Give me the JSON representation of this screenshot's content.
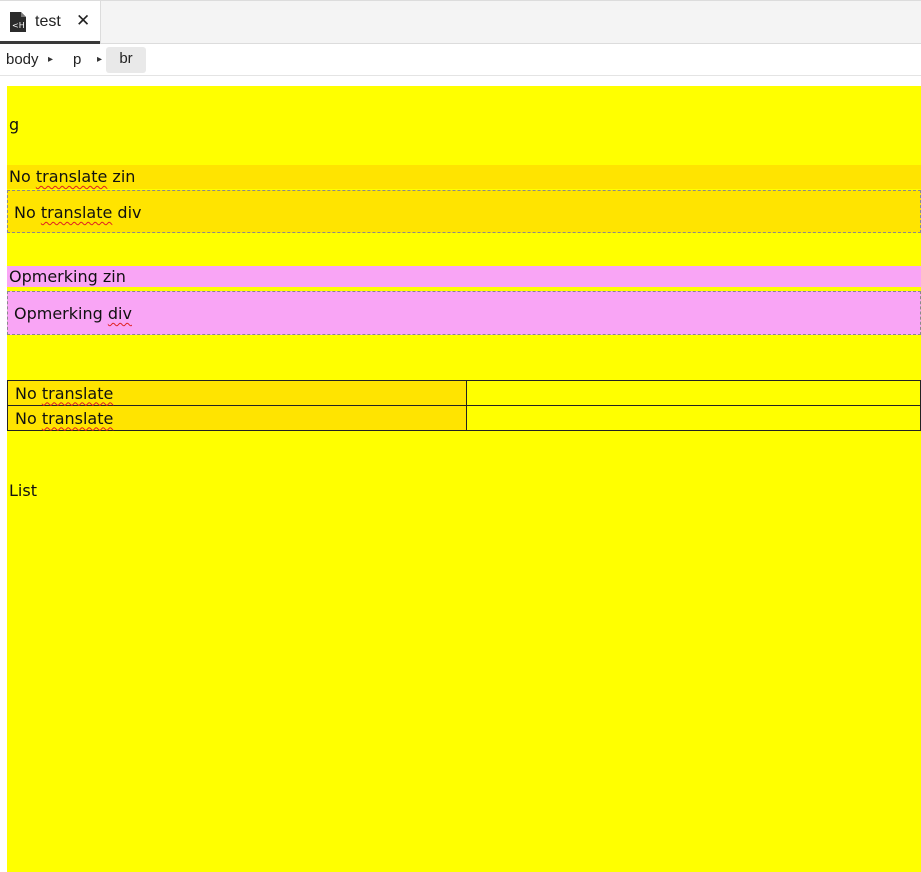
{
  "tab": {
    "title": "test",
    "close_glyph": "✕",
    "icon": "html-file-icon"
  },
  "breadcrumb": {
    "items": [
      "body",
      "p",
      "br"
    ],
    "separator_glyph": "▸"
  },
  "colors": {
    "background": "#ffff00",
    "no_translate": "#ffe400",
    "remark": "#f9a5f5"
  },
  "editor": {
    "line_g": "g",
    "no_translate_sentence": {
      "prefix": "No ",
      "marked": "translate",
      "suffix": " zin"
    },
    "no_translate_div": {
      "prefix": "No ",
      "marked": "translate",
      "suffix": " div"
    },
    "remark_sentence": "Opmerking zin",
    "remark_div": {
      "prefix": "Opmerking ",
      "marked": "div"
    },
    "table_rows": [
      {
        "prefix": "No ",
        "marked": "translate",
        "cell2": ""
      },
      {
        "prefix": "No ",
        "marked": "translate",
        "cell2": ""
      }
    ],
    "list_label": "List"
  }
}
